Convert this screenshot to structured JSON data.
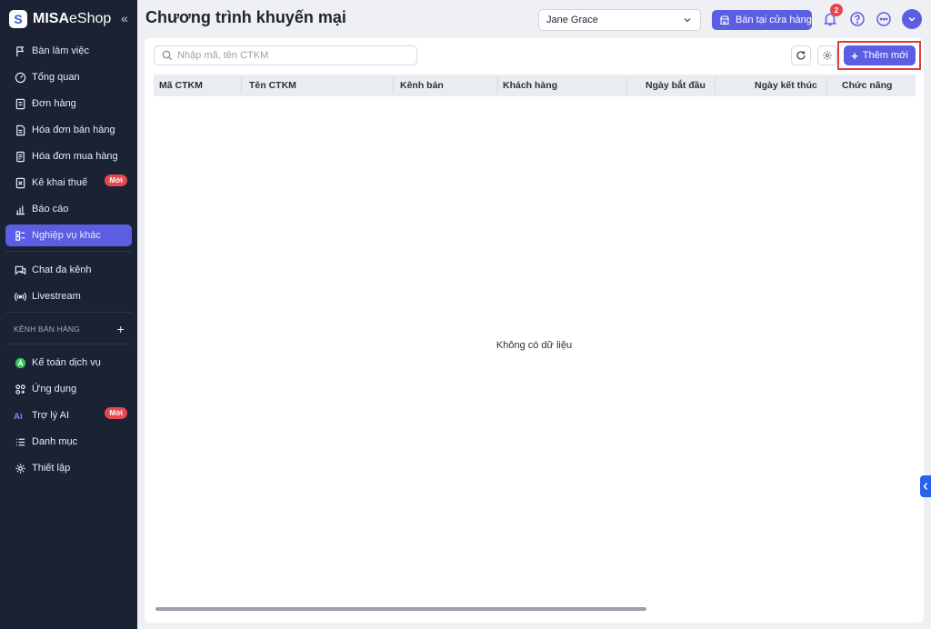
{
  "brand": {
    "mark": "S",
    "name_bold": "MISA",
    "name_rest": "eShop",
    "collapse": "«"
  },
  "sidebar": {
    "items_top": [
      {
        "label": "Bàn làm việc",
        "icon": "flag-icon"
      },
      {
        "label": "Tổng quan",
        "icon": "gauge-icon"
      },
      {
        "label": "Đơn hàng",
        "icon": "order-icon"
      },
      {
        "label": "Hóa đơn bán hàng",
        "icon": "invoice-icon"
      },
      {
        "label": "Hóa đơn mua hàng",
        "icon": "purchase-invoice-icon"
      },
      {
        "label": "Kê khai thuế",
        "icon": "tax-icon",
        "badge": "Mới"
      },
      {
        "label": "Báo cáo",
        "icon": "report-icon"
      },
      {
        "label": "Nghiệp vụ khác",
        "icon": "operations-icon",
        "active": true
      }
    ],
    "items_mid": [
      {
        "label": "Chat đa kênh",
        "icon": "chat-icon"
      },
      {
        "label": "Livestream",
        "icon": "livestream-icon"
      }
    ],
    "section_title": "KÊNH BÁN HÀNG",
    "section_add": "+",
    "items_bottom": [
      {
        "label": "Kế toán dịch vụ",
        "icon": "accounting-icon"
      },
      {
        "label": "Ứng dụng",
        "icon": "apps-icon"
      },
      {
        "label": "Trợ lý AI",
        "icon": "ai-icon",
        "badge": "Mới"
      },
      {
        "label": "Danh mục",
        "icon": "list-icon"
      },
      {
        "label": "Thiết lập",
        "icon": "settings-icon"
      }
    ]
  },
  "header": {
    "title": "Chương trình khuyến mại",
    "user_select_value": "Jane Grace",
    "store_button": "Bán tại cửa hàng",
    "notification_count": "2"
  },
  "main": {
    "search_placeholder": "Nhập mã, tên CTKM",
    "add_button": "Thêm mới",
    "columns": [
      "Mã CTKM",
      "Tên CTKM",
      "Kênh bán",
      "Khách hàng",
      "Ngày bắt đầu",
      "Ngày kết thúc",
      "Chức năng"
    ],
    "empty_text": "Không có dữ liệu"
  },
  "colors": {
    "accent": "#5b5ee3",
    "sidebar_bg": "#1a2233",
    "highlight": "#e23b3b",
    "badge": "#e5484d"
  }
}
